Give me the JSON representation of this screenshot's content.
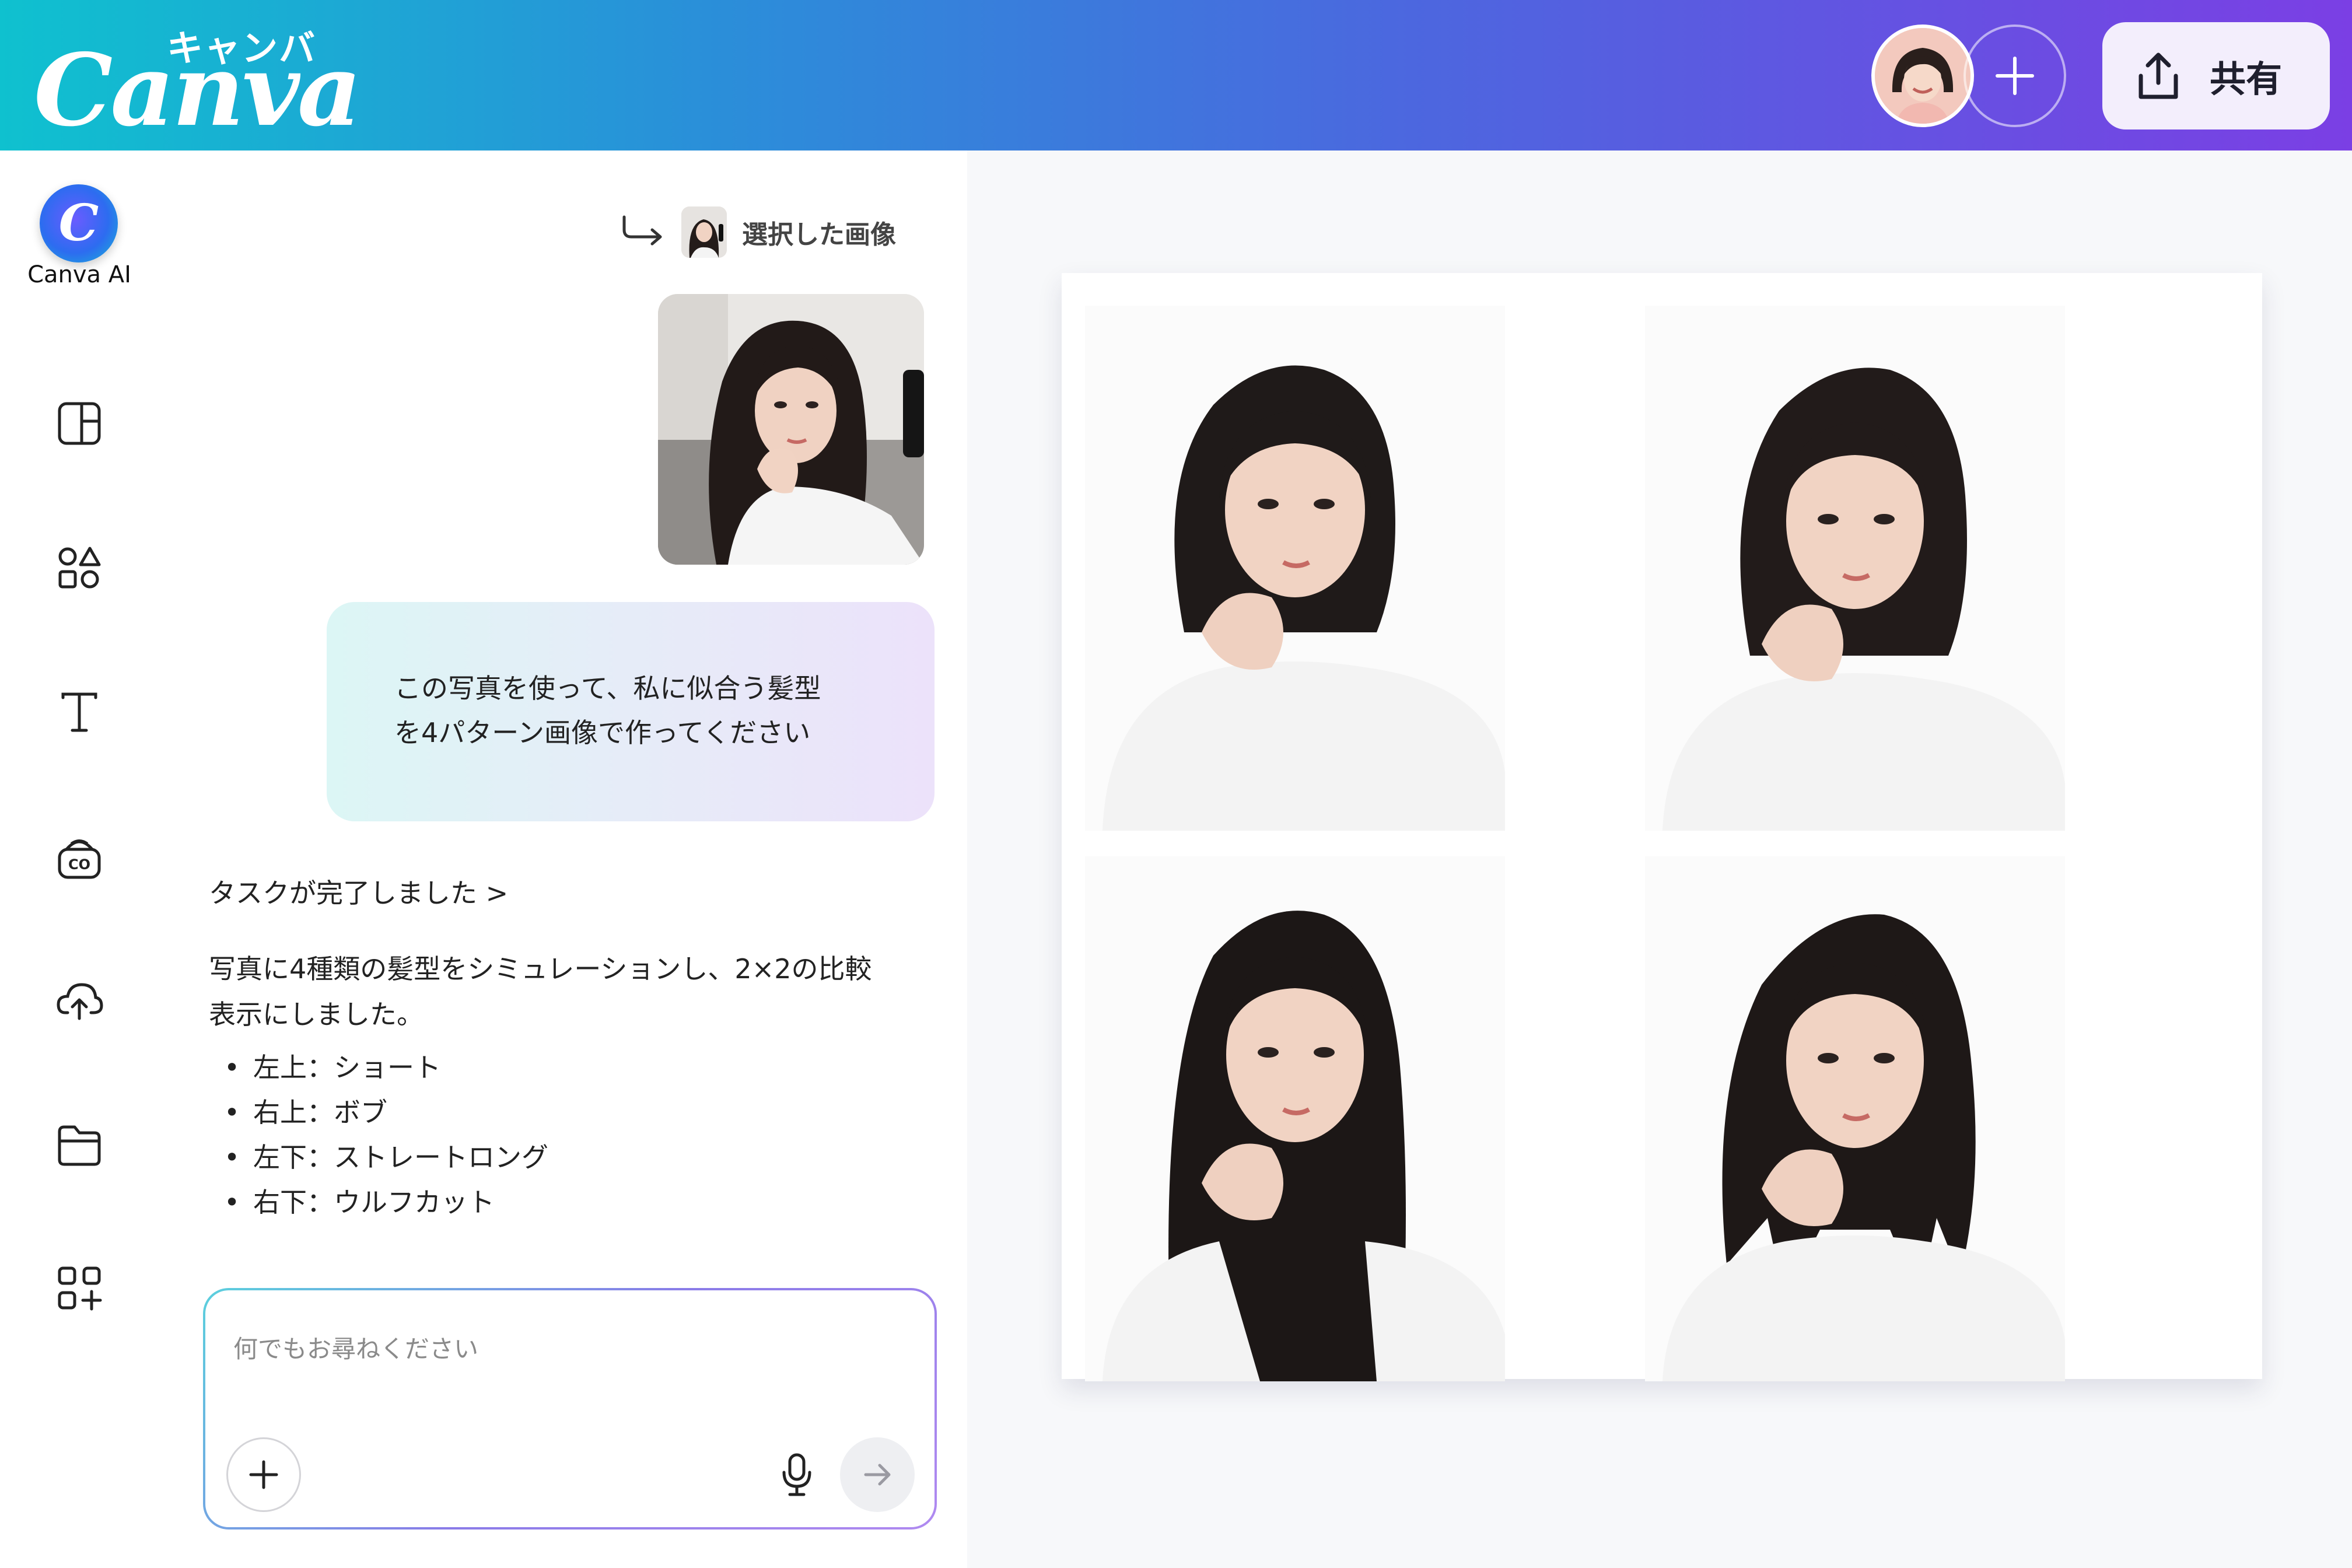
{
  "header": {
    "logo_text": "Canva",
    "logo_kana": "キャンバ",
    "share_label": "共有"
  },
  "rail": {
    "ai_label": "Canva AI",
    "icons": [
      "design-layout-icon",
      "elements-icon",
      "text-icon",
      "brand-icon",
      "uploads-icon",
      "projects-folder-icon",
      "apps-icon"
    ]
  },
  "chat": {
    "selected_image_label": "選択した画像",
    "user_message_line1": "この写真を使って、私に似合う髪型",
    "user_message_line2": "を4パターン画像で作ってください",
    "task_status": "タスクが完了しました >",
    "reply_line1": "写真に4種類の髪型をシミュレーションし、2×2の比較",
    "reply_line2": "表示にしました。",
    "reply_items": [
      "左上：ショート",
      "右上：ボブ",
      "左下：ストレートロング",
      "右下：ウルフカット"
    ],
    "input_placeholder": "何でもお尋ねください"
  },
  "colors": {
    "header_gradient_start": "#0fc1cf",
    "header_gradient_end": "#7b3fe4",
    "bubble_start": "#dcf6f5",
    "bubble_end": "#ece2fa",
    "hair": "#1f1a19",
    "skin": "#f1d3c3",
    "shirt": "#f4f4f4"
  }
}
